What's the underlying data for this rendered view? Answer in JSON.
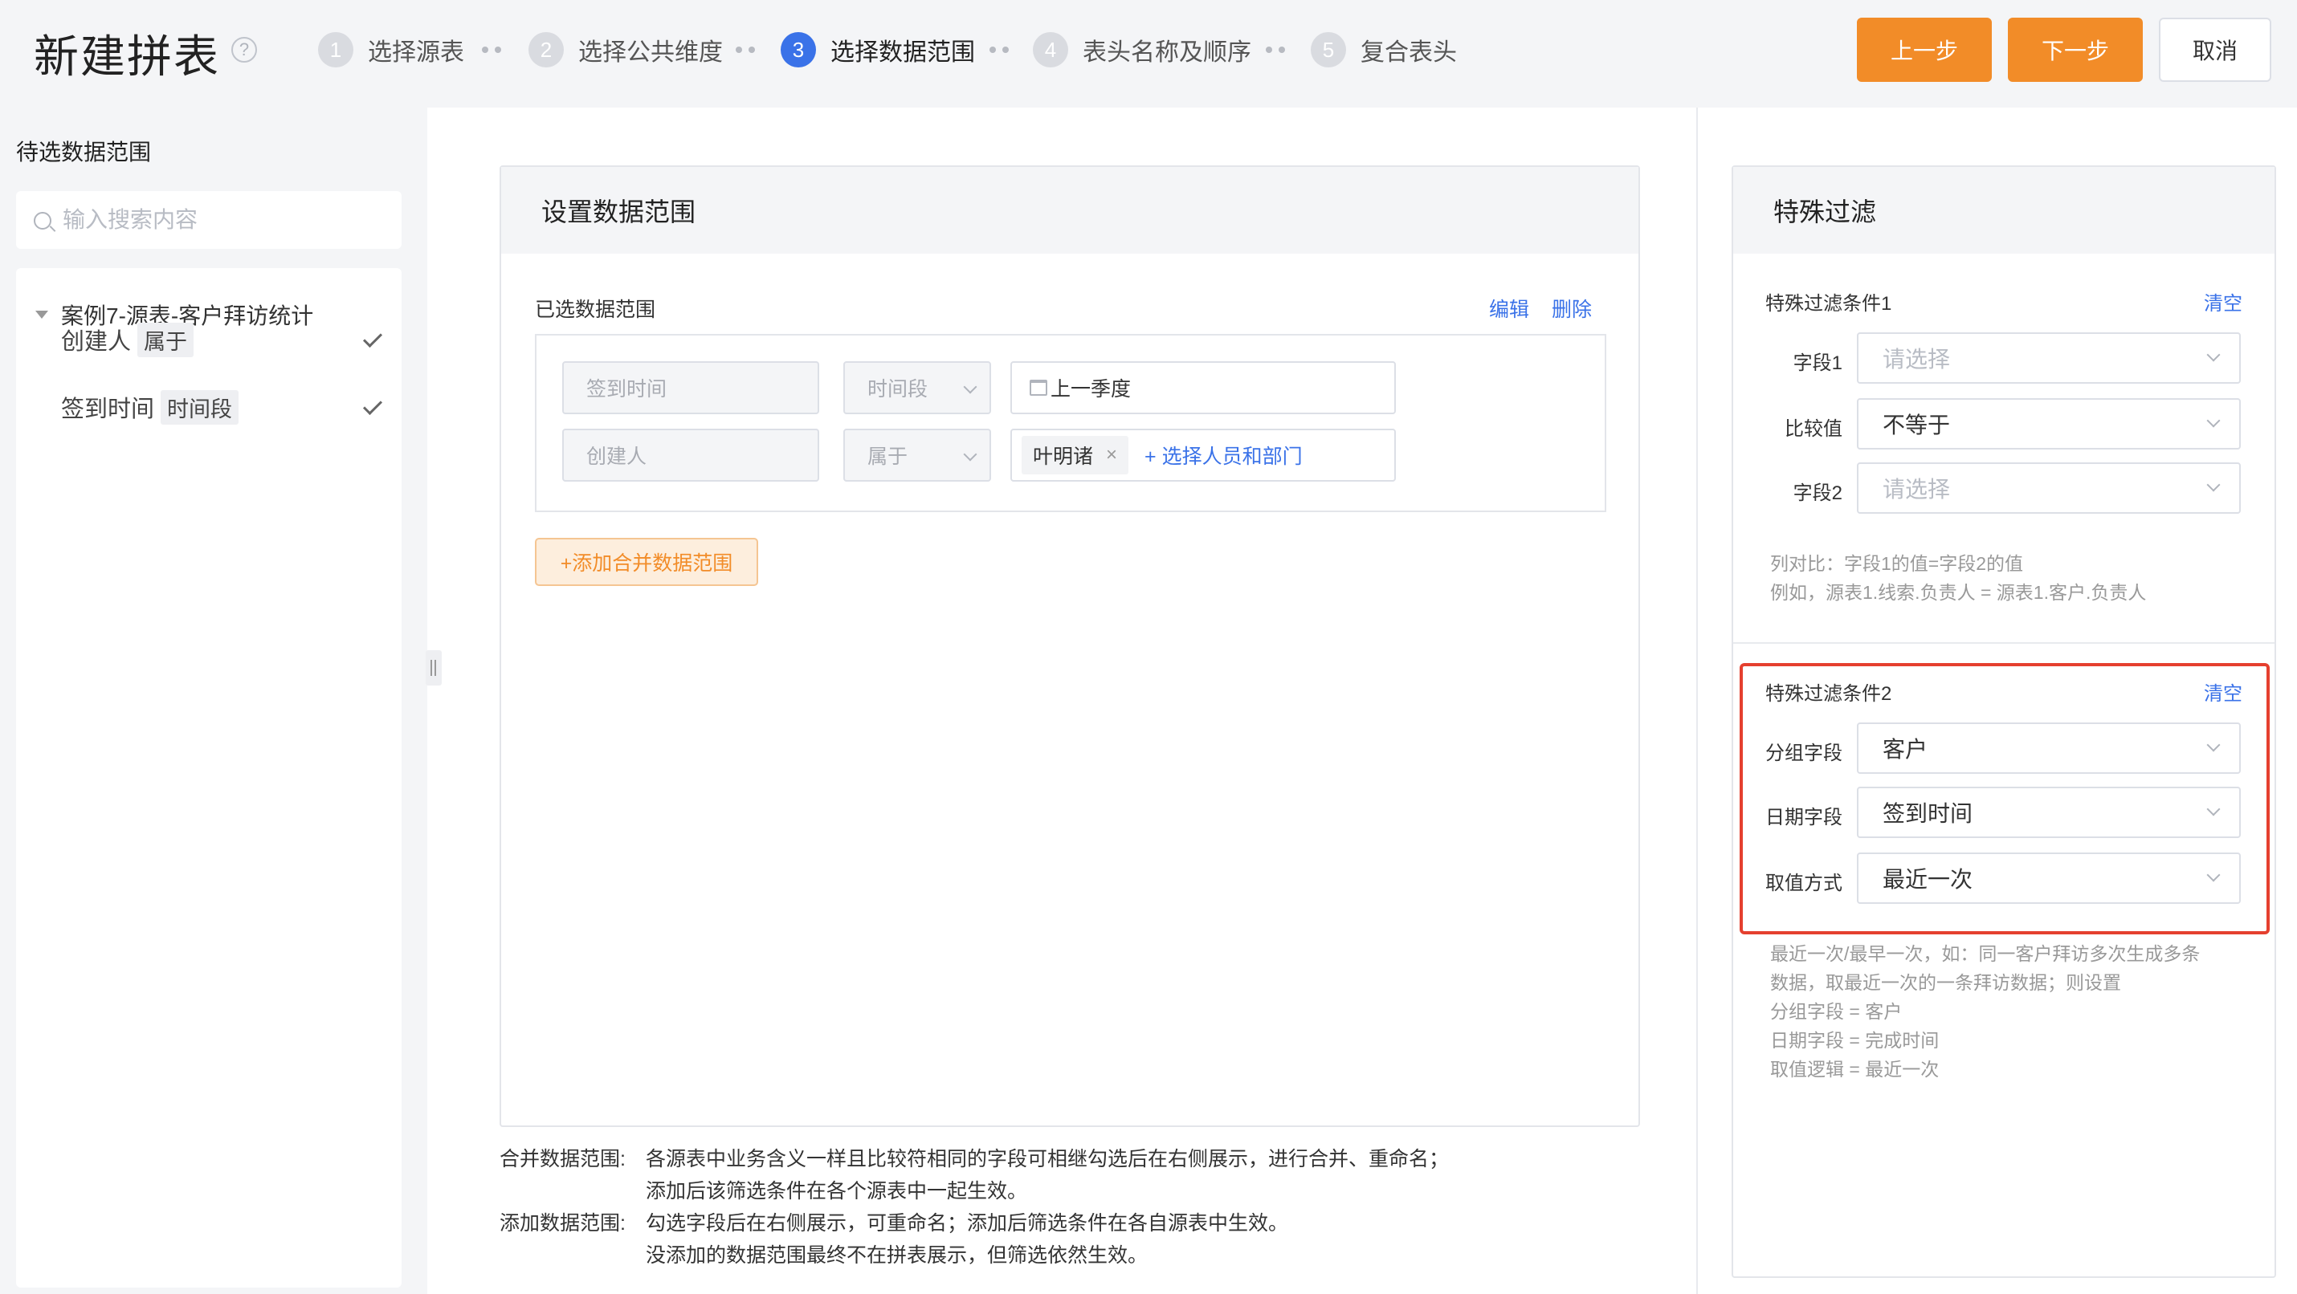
{
  "header": {
    "title": "新建拼表",
    "steps": [
      {
        "num": "1",
        "label": "选择源表"
      },
      {
        "num": "2",
        "label": "选择公共维度"
      },
      {
        "num": "3",
        "label": "选择数据范围"
      },
      {
        "num": "4",
        "label": "表头名称及顺序"
      },
      {
        "num": "5",
        "label": "复合表头"
      }
    ],
    "active_step": 3,
    "prev_label": "上一步",
    "next_label": "下一步",
    "cancel_label": "取消",
    "accent_color": "#f28c28",
    "step_active_color": "#3a72e8"
  },
  "left": {
    "title": "待选数据范围",
    "search_placeholder": "输入搜索内容",
    "tree_root": "案例7-源表-客户拜访统计",
    "items": [
      {
        "name": "创建人",
        "tag": "属于",
        "checked": true
      },
      {
        "name": "签到时间",
        "tag": "时间段",
        "checked": true
      }
    ]
  },
  "middle": {
    "card_title": "设置数据范围",
    "selected_title": "已选数据范围",
    "edit_label": "编辑",
    "delete_label": "删除",
    "rows": [
      {
        "field": "签到时间",
        "operator": "时间段",
        "value": "上一季度"
      },
      {
        "field": "创建人",
        "operator": "属于",
        "tag": "叶明诸",
        "picker": "+ 选择人员和部门"
      }
    ],
    "add_button": "+添加合并数据范围",
    "notes": [
      {
        "key": "合并数据范围:",
        "lines": [
          "各源表中业务含义一样且比较符相同的字段可相继勾选后在右侧展示，进行合并、重命名；",
          "添加后该筛选条件在各个源表中一起生效。"
        ]
      },
      {
        "key": "添加数据范围:",
        "lines": [
          "勾选字段后在右侧展示，可重命名；添加后筛选条件在各自源表中生效。",
          "没添加的数据范围最终不在拼表展示，但筛选依然生效。"
        ]
      }
    ]
  },
  "right": {
    "card_title": "特殊过滤",
    "cond1": {
      "title": "特殊过滤条件1",
      "clear": "清空",
      "field1_label": "字段1",
      "field1_placeholder": "请选择",
      "compare_label": "比较值",
      "compare_value": "不等于",
      "field2_label": "字段2",
      "field2_placeholder": "请选择",
      "hint_lines": [
        "列对比：字段1的值=字段2的值",
        "例如，源表1.线索.负责人 = 源表1.客户.负责人"
      ]
    },
    "cond2": {
      "title": "特殊过滤条件2",
      "clear": "清空",
      "group_label": "分组字段",
      "group_value": "客户",
      "date_label": "日期字段",
      "date_value": "签到时间",
      "mode_label": "取值方式",
      "mode_value": "最近一次",
      "highlight_color": "#e5402f",
      "hint_lines": [
        "最近一次/最早一次，如：同一客户拜访多次生成多条",
        "数据，取最近一次的一条拜访数据；则设置",
        "分组字段 = 客户",
        "日期字段 = 完成时间",
        "取值逻辑 = 最近一次"
      ]
    }
  }
}
